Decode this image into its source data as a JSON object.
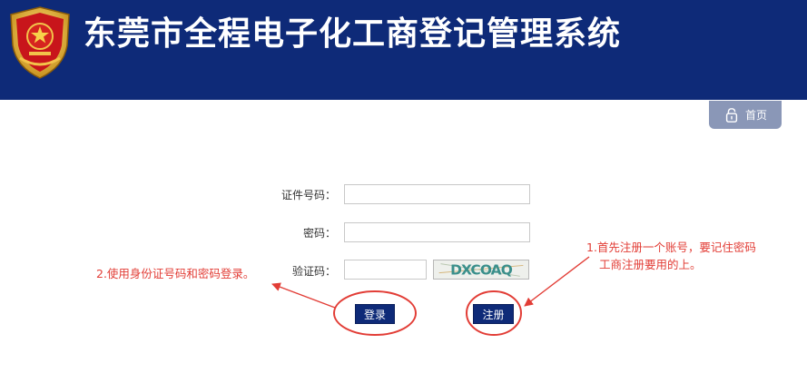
{
  "header": {
    "title": "东莞市全程电子化工商登记管理系统"
  },
  "nav": {
    "home_label": "首页",
    "home_icon": "lock-icon"
  },
  "form": {
    "id_label": "证件号码：",
    "id_value": "",
    "password_label": "密码：",
    "password_value": "",
    "captcha_label": "验证码：",
    "captcha_value": "",
    "captcha_text": "DXCOAQ",
    "login_label": "登录",
    "register_label": "注册"
  },
  "annotations": {
    "register_tip_line1": "1.首先注册一个账号，要记住密码",
    "register_tip_line2": "工商注册要用的上。",
    "login_tip": "2.使用身份证号码和密码登录。"
  },
  "colors": {
    "header_bg": "#0e2a78",
    "annotation_red": "#e23d36",
    "button_bg": "#0e2a78"
  }
}
